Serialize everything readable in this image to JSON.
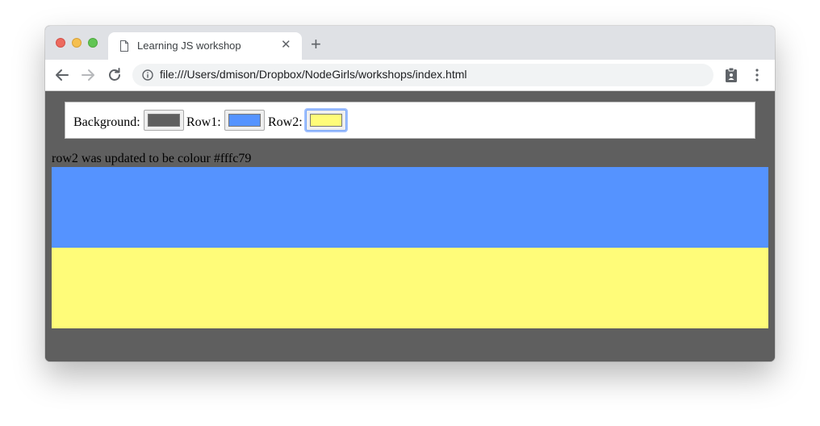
{
  "browser": {
    "tab": {
      "title": "Learning JS workshop"
    },
    "url": "file:///Users/dmison/Dropbox/NodeGirls/workshops/index.html",
    "icons": {
      "tab": "document-icon",
      "close": "close-icon",
      "new_tab": "plus-icon",
      "back": "arrow-left-icon",
      "forward": "arrow-right-icon",
      "reload": "reload-icon",
      "info": "info-icon",
      "extension": "clipboard-icon",
      "menu": "kebab-menu-icon"
    },
    "glyphs": {
      "close": "✕",
      "new_tab": "+"
    }
  },
  "page": {
    "controls": {
      "background_label": "Background:",
      "row1_label": "Row1:",
      "row2_label": "Row2:",
      "background_color": "#5f5f5f",
      "row1_color": "#5593ff",
      "row2_color": "#fffc79"
    },
    "message": "row2 was updated to be colour #fffc79"
  }
}
